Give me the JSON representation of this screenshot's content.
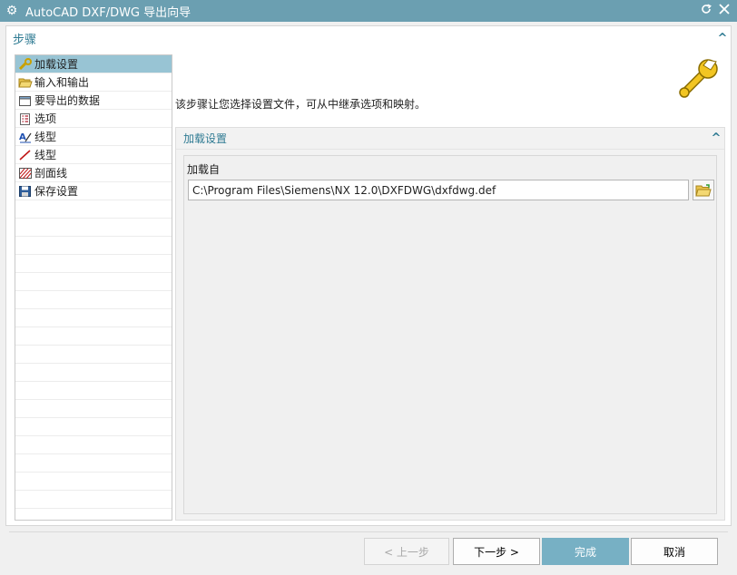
{
  "window": {
    "title": "AutoCAD DXF/DWG 导出向导",
    "icon": "gear-icon",
    "controls": [
      "reset-icon",
      "close-icon"
    ]
  },
  "steps_panel": {
    "label": "步骤",
    "items": [
      {
        "label": "加载设置",
        "icon": "wrench-icon",
        "selected": true
      },
      {
        "label": "输入和输出",
        "icon": "folder-open-icon",
        "selected": false
      },
      {
        "label": "要导出的数据",
        "icon": "data-window-icon",
        "selected": false
      },
      {
        "label": "选项",
        "icon": "options-list-icon",
        "selected": false
      },
      {
        "label": "线型",
        "icon": "text-style-icon",
        "selected": false
      },
      {
        "label": "线型",
        "icon": "line-icon",
        "selected": false
      },
      {
        "label": "剖面线",
        "icon": "hatch-icon",
        "selected": false
      },
      {
        "label": "保存设置",
        "icon": "save-icon",
        "selected": false
      }
    ]
  },
  "content": {
    "description": "该步骤让您选择设置文件，可从中继承选项和映射。",
    "hero_icon": "wrench-icon",
    "group": {
      "title": "加载设置",
      "load_from_label": "加载自",
      "path_value": "C:\\Program Files\\Siemens\\NX 12.0\\DXFDWG\\dxfdwg.def",
      "browse_icon": "folder-open-icon"
    }
  },
  "buttons": {
    "back": "< 上一步",
    "next": "下一步 >",
    "finish": "完成",
    "cancel": "取消"
  },
  "colors": {
    "titlebar": "#6b9fb1",
    "accent_text": "#2f7b93",
    "selection": "#98c4d4",
    "primary_button": "#77b0c4"
  }
}
